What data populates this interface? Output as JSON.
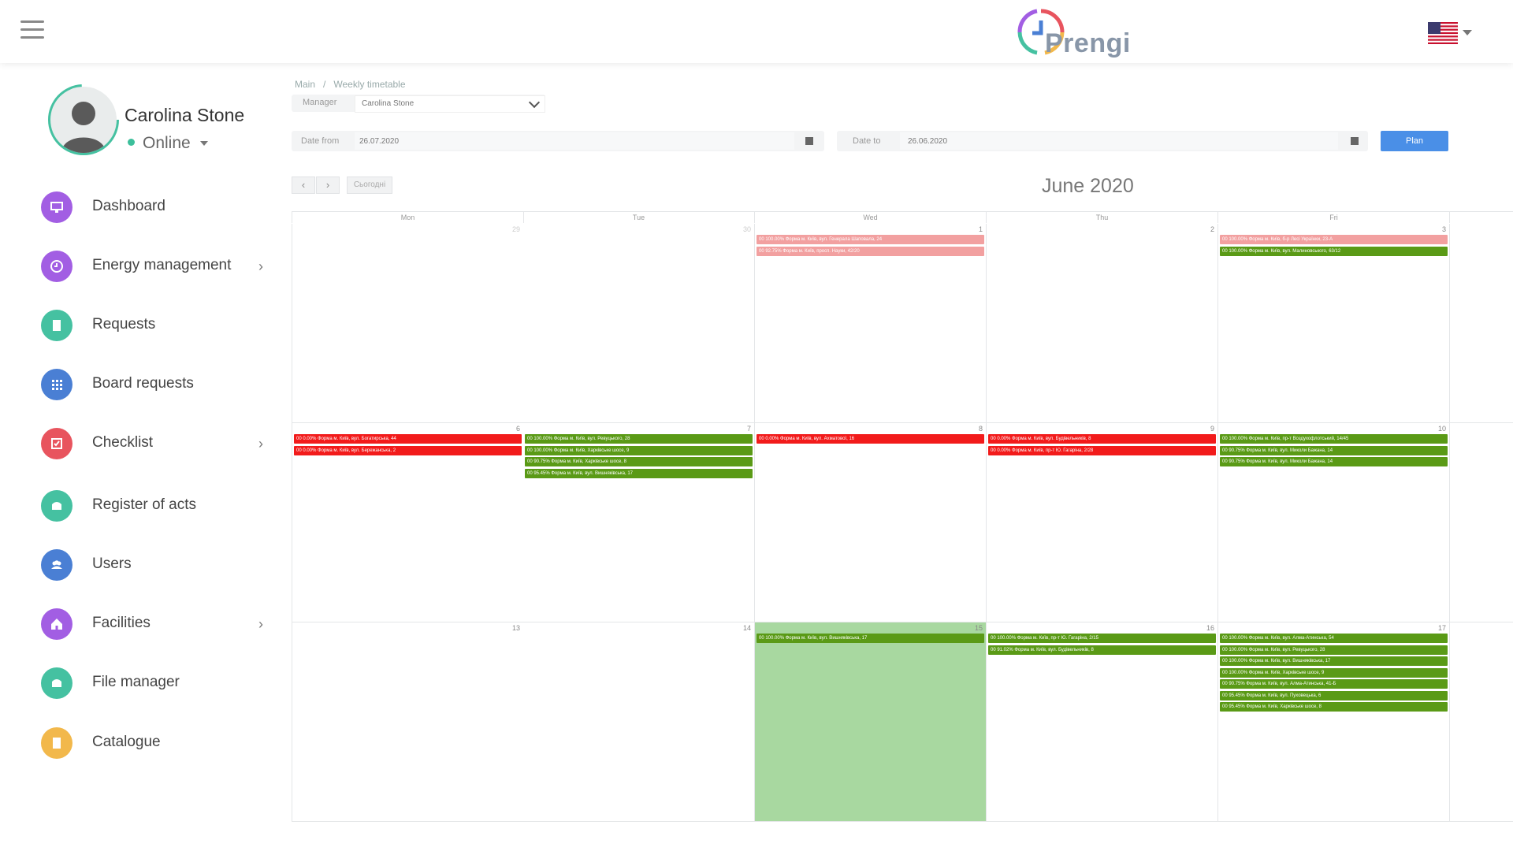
{
  "app": {
    "logo_text": "Prengi"
  },
  "user": {
    "name": "Carolina Stone",
    "status": "Online"
  },
  "sidebar": {
    "items": [
      {
        "label": "Dashboard",
        "color": "#a25ee3",
        "icon": "monitor-icon",
        "has_submenu": false
      },
      {
        "label": "Energy management",
        "color": "#a25ee3",
        "icon": "clock-icon",
        "has_submenu": true
      },
      {
        "label": "Requests",
        "color": "#45c1a1",
        "icon": "document-icon",
        "has_submenu": false
      },
      {
        "label": "Board requests",
        "color": "#4a7fd4",
        "icon": "grid-icon",
        "has_submenu": false
      },
      {
        "label": "Checklist",
        "color": "#e8545e",
        "icon": "checklist-icon",
        "has_submenu": true
      },
      {
        "label": "Register of acts",
        "color": "#45c1a1",
        "icon": "register-icon",
        "has_submenu": false
      },
      {
        "label": "Users",
        "color": "#4a7fd4",
        "icon": "users-icon",
        "has_submenu": false
      },
      {
        "label": "Facilities",
        "color": "#a25ee3",
        "icon": "home-icon",
        "has_submenu": true
      },
      {
        "label": "File manager",
        "color": "#45c1a1",
        "icon": "folder-icon",
        "has_submenu": false
      },
      {
        "label": "Catalogue",
        "color": "#f2b84b",
        "icon": "catalogue-icon",
        "has_submenu": false
      }
    ]
  },
  "breadcrumb": {
    "home": "Main",
    "separator": "/",
    "current": "Weekly timetable"
  },
  "filters": {
    "manager_label": "Manager",
    "manager_value": "Carolina Stone",
    "date_from_label": "Date from",
    "date_from_value": "26.07.2020",
    "date_to_label": "Date to",
    "date_to_value": "26.06.2020",
    "plan_button": "Plan"
  },
  "toolbar": {
    "prev": "‹",
    "next": "›",
    "today": "Сьогодні"
  },
  "calendar": {
    "month_title": "June 2020",
    "weekdays": [
      "Mon",
      "Tue",
      "Wed",
      "Thu",
      "Fri"
    ],
    "highlight_color": "#a8d8a0",
    "weeks": [
      {
        "days": [
          {
            "num": "29",
            "muted": true,
            "events": []
          },
          {
            "num": "30",
            "muted": true,
            "events": []
          },
          {
            "num": "1",
            "muted": false,
            "events": [
              {
                "text": "00 100.00% Форма м. Київ, вул. Генерала Шаповала, 24",
                "color": "pink"
              },
              {
                "text": "00 92.75% Форма м. Київ, просп. Науки, 42/20",
                "color": "pink"
              }
            ]
          },
          {
            "num": "2",
            "muted": false,
            "events": []
          },
          {
            "num": "3",
            "muted": false,
            "events": [
              {
                "text": "00 100.00% Форма м. Київ, б-р Лесі Українки, 23-А",
                "color": "pink"
              },
              {
                "text": "00 100.00% Форма м. Київ, вул. Малиновського, 63/12",
                "color": "green"
              }
            ]
          }
        ]
      },
      {
        "days": [
          {
            "num": "6",
            "muted": false,
            "events": [
              {
                "text": "00 0.00% Форма м. Київ, вул. Богатирська, 44",
                "color": "red"
              },
              {
                "text": "00 0.00% Форма м. Київ, вул. Бережанська, 2",
                "color": "red"
              }
            ]
          },
          {
            "num": "7",
            "muted": false,
            "events": [
              {
                "text": "00 100.00% Форма м. Київ, вул. Ревуцького, 28",
                "color": "green"
              },
              {
                "text": "00 100.00% Форма м. Київ, Харківське шосе, 9",
                "color": "green"
              },
              {
                "text": "00 90.75% Форма м. Київ, Харківське шосе, 8",
                "color": "green"
              },
              {
                "text": "00 95.45% Форма м. Київ, вул. Вишняківська, 17",
                "color": "green"
              }
            ]
          },
          {
            "num": "8",
            "muted": false,
            "events": [
              {
                "text": "00 0.00% Форма м. Київ, вул. Ахматової, 16",
                "color": "red"
              }
            ]
          },
          {
            "num": "9",
            "muted": false,
            "events": [
              {
                "text": "00 0.00% Форма м. Київ, вул. Будівельників, 8",
                "color": "red"
              },
              {
                "text": "00 0.00% Форма м. Київ, пр-т Ю. Гагаріна, 2/28",
                "color": "red"
              }
            ]
          },
          {
            "num": "10",
            "muted": false,
            "events": [
              {
                "text": "00 100.00% Форма м. Київ, пр-т Воздухофлотський, 14/45",
                "color": "green"
              },
              {
                "text": "00 90.75% Форма м. Київ, вул. Миколи Бажана, 14",
                "color": "green"
              },
              {
                "text": "00 90.75% Форма м. Київ, вул. Миколи Бажана, 14",
                "color": "green"
              }
            ]
          }
        ]
      },
      {
        "days": [
          {
            "num": "13",
            "muted": false,
            "events": []
          },
          {
            "num": "14",
            "muted": false,
            "events": []
          },
          {
            "num": "15",
            "muted": false,
            "highlight": true,
            "events": [
              {
                "text": "00 100.00% Форма м. Київ, вул. Вишняківська, 17",
                "color": "green"
              }
            ]
          },
          {
            "num": "16",
            "muted": false,
            "events": [
              {
                "text": "00 100.00% Форма м. Київ, пр-т Ю. Гагаріна, 2/15",
                "color": "green"
              },
              {
                "text": "00 91.02% Форма м. Київ, вул. Будівельників, 8",
                "color": "green"
              }
            ]
          },
          {
            "num": "17",
            "muted": false,
            "events": [
              {
                "text": "00 100.00% Форма м. Київ, вул. Алма-Атинська, 54",
                "color": "green"
              },
              {
                "text": "00 100.00% Форма м. Київ, вул. Ревуцького, 28",
                "color": "green"
              },
              {
                "text": "00 100.00% Форма м. Київ, вул. Вишняківська, 17",
                "color": "green"
              },
              {
                "text": "00 100.00% Форма м. Київ, Харківське шосе, 9",
                "color": "green"
              },
              {
                "text": "00 90.75% Форма м. Київ, вул. Алма-Атинська, 41-Б",
                "color": "green"
              },
              {
                "text": "00 95.45% Форма м. Київ, вул. Пуховецька, 6",
                "color": "green"
              },
              {
                "text": "00 95.45% Форма м. Київ, Харківське шосе, 8",
                "color": "green"
              }
            ]
          }
        ]
      }
    ]
  }
}
